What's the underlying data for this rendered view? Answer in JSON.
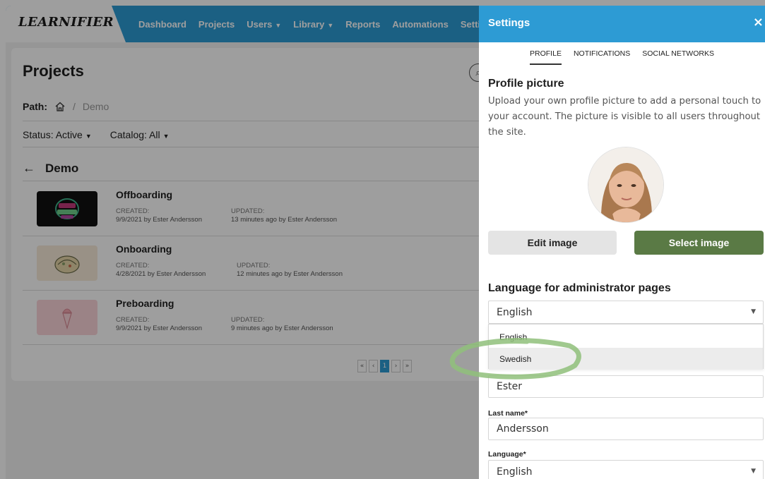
{
  "app": {
    "logo": "LEARNIFIER",
    "nav": [
      {
        "label": "Dashboard",
        "dropdown": false
      },
      {
        "label": "Projects",
        "dropdown": false
      },
      {
        "label": "Users",
        "dropdown": true
      },
      {
        "label": "Library",
        "dropdown": true
      },
      {
        "label": "Reports",
        "dropdown": false
      },
      {
        "label": "Automations",
        "dropdown": false
      },
      {
        "label": "Settings",
        "dropdown": false
      }
    ]
  },
  "projects_page": {
    "title": "Projects",
    "path_label": "Path:",
    "path_separator": "/",
    "path_current": "Demo",
    "status_label": "Status:",
    "status_value": "Active",
    "catalog_label": "Catalog:",
    "catalog_value": "All",
    "folder": "Demo",
    "created_label": "CREATED:",
    "updated_label": "UPDATED:",
    "projects": [
      {
        "name": "Offboarding",
        "created": "9/9/2021 by Ester Andersson",
        "updated": "13 minutes ago by Ester Andersson"
      },
      {
        "name": "Onboarding",
        "created": "4/28/2021 by Ester Andersson",
        "updated": "12 minutes ago by Ester Andersson"
      },
      {
        "name": "Preboarding",
        "created": "9/9/2021 by Ester Andersson",
        "updated": "9 minutes ago by Ester Andersson"
      }
    ],
    "pager": {
      "first": "«",
      "prev": "‹",
      "current": "1",
      "next": "›",
      "last": "»"
    }
  },
  "settings": {
    "title": "Settings",
    "close": "×",
    "tabs": [
      "PROFILE",
      "NOTIFICATIONS",
      "SOCIAL NETWORKS"
    ],
    "active_tab": "PROFILE",
    "profile_picture_title": "Profile picture",
    "profile_picture_desc": "Upload your own profile picture to add a personal touch to your account. The picture is visible to all users throughout the site.",
    "edit_image": "Edit image",
    "select_image": "Select image",
    "admin_language_title": "Language for administrator pages",
    "admin_language_value": "English",
    "admin_language_options": [
      "English",
      "Swedish"
    ],
    "highlighted_option": "Swedish",
    "first_name_value": "Ester",
    "last_name_label": "Last name*",
    "last_name_value": "Andersson",
    "language_label": "Language*",
    "language_value": "English"
  },
  "colors": {
    "header_blue": "#2d9bd4",
    "select_green": "#5a7a45",
    "highlight_ring": "#8fbf7a"
  }
}
